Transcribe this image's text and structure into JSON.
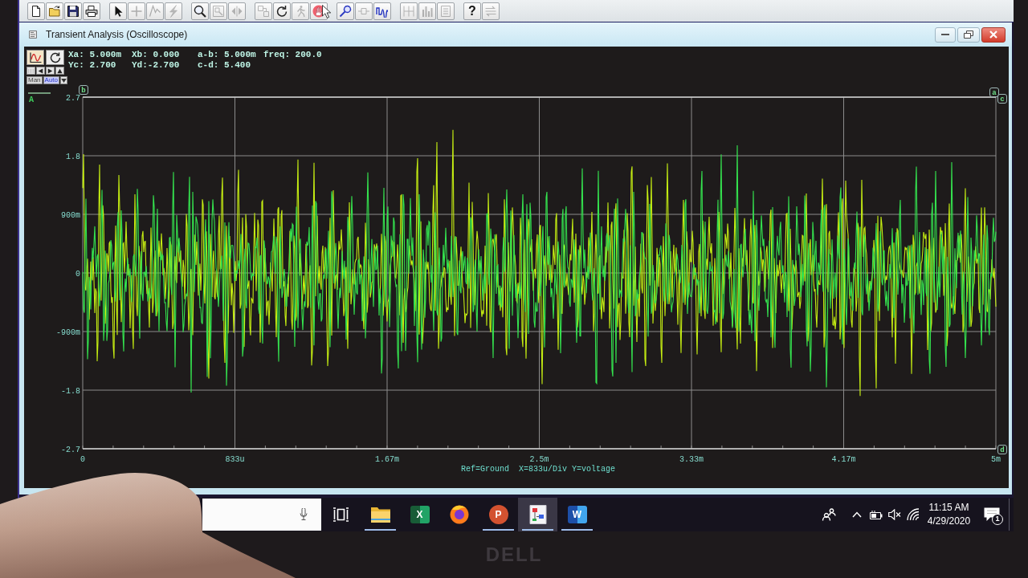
{
  "toolbar": {
    "groups": [
      [
        {
          "kind": "new",
          "disabled": false
        },
        {
          "kind": "open",
          "disabled": false
        },
        {
          "kind": "save",
          "disabled": false
        },
        {
          "kind": "print",
          "disabled": false
        }
      ],
      [
        {
          "kind": "pointer",
          "disabled": false
        },
        {
          "kind": "junction",
          "disabled": true
        },
        {
          "kind": "wire",
          "disabled": true
        },
        {
          "kind": "bolt",
          "disabled": true
        }
      ],
      [
        {
          "kind": "zoom",
          "disabled": false
        },
        {
          "kind": "zoom_area",
          "disabled": true
        },
        {
          "kind": "zoom_fit",
          "disabled": true
        }
      ],
      [
        {
          "kind": "grid",
          "disabled": true
        },
        {
          "kind": "rotate",
          "disabled": false
        },
        {
          "kind": "runner",
          "disabled": true
        },
        {
          "kind": "hand",
          "disabled": false
        }
      ],
      [
        {
          "kind": "probe",
          "disabled": false
        },
        {
          "kind": "bus",
          "disabled": true
        },
        {
          "kind": "wave",
          "disabled": false
        }
      ],
      [
        {
          "kind": "split",
          "disabled": true
        },
        {
          "kind": "bars",
          "disabled": true
        },
        {
          "kind": "page",
          "disabled": true
        }
      ],
      [
        {
          "kind": "text",
          "label": "?",
          "disabled": false
        },
        {
          "kind": "swap",
          "disabled": true
        }
      ]
    ]
  },
  "window": {
    "title": "Transient Analysis (Oscilloscope)"
  },
  "scope": {
    "controls": {
      "nav": [
        {
          "kind": "bars",
          "disabled": true
        },
        {
          "kind": "left",
          "disabled": false
        },
        {
          "kind": "right",
          "disabled": false
        },
        {
          "kind": "up",
          "disabled": false
        }
      ],
      "modes": [
        {
          "label": "Man",
          "selected": false
        },
        {
          "label": "Auto",
          "selected": true
        }
      ]
    },
    "readouts": [
      [
        "Xa: 5.000m",
        "Xb: 0.000",
        "a-b: 5.000m",
        "freq: 200.0"
      ],
      [
        "Yc: 2.700",
        "Yd:-2.700",
        "c-d: 5.400"
      ]
    ],
    "channel": "A",
    "y_labels": [
      "2.7",
      "1.8",
      "900m",
      "0",
      "-900m",
      "-1.8",
      "-2.7"
    ],
    "x_labels": [
      "0",
      "833u",
      "1.67m",
      "2.5m",
      "3.33m",
      "4.17m",
      "5m"
    ],
    "cursors": [
      "b",
      "a",
      "c",
      "d"
    ],
    "caption": "Ref=Ground  X=833u/Div Y=voltage"
  },
  "taskbar": {
    "apps": [
      {
        "kind": "task_view",
        "running": false,
        "selected": false
      },
      {
        "kind": "folder",
        "running": true,
        "selected": false
      },
      {
        "kind": "sheet",
        "label": "X",
        "running": false,
        "selected": false
      },
      {
        "kind": "browser",
        "running": false,
        "selected": false
      },
      {
        "kind": "slides",
        "label": "P",
        "running": true,
        "selected": false
      },
      {
        "kind": "diagram",
        "running": true,
        "selected": true
      },
      {
        "kind": "doc",
        "label": "W",
        "running": true,
        "selected": false
      }
    ],
    "tray": {
      "volume_muted": true,
      "time": "11:15 AM",
      "date": "4/29/2020",
      "notifications": "1"
    }
  },
  "bezel": {
    "logo": "DELL"
  }
}
